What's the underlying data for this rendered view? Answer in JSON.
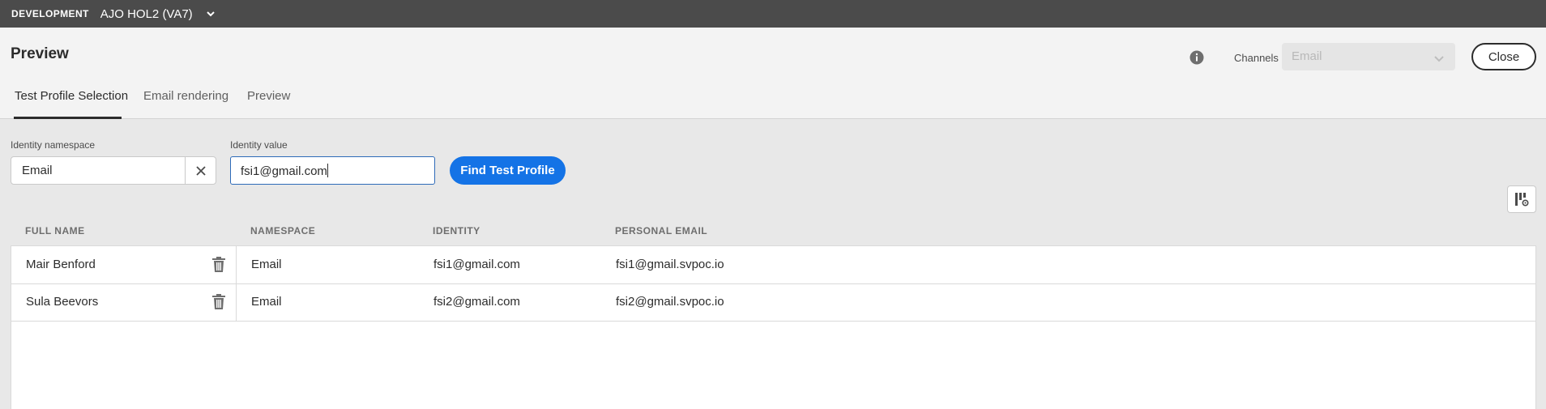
{
  "topbar": {
    "environment": "DEVELOPMENT",
    "sandbox": "AJO HOL2 (VA7)"
  },
  "header": {
    "title": "Preview",
    "channels_label": "Channels",
    "channel_value": "Email",
    "close_label": "Close"
  },
  "tabs": [
    {
      "label": "Test Profile Selection",
      "active": true
    },
    {
      "label": "Email rendering"
    },
    {
      "label": "Preview"
    }
  ],
  "form": {
    "namespace_label": "Identity namespace",
    "namespace_value": "Email",
    "identity_label": "Identity value",
    "identity_value": "fsi1@gmail.com",
    "find_label": "Find Test Profile"
  },
  "table": {
    "columns": [
      "FULL NAME",
      "NAMESPACE",
      "IDENTITY",
      "PERSONAL EMAIL"
    ],
    "rows": [
      {
        "full_name": "Mair Benford",
        "namespace": "Email",
        "identity": "fsi1@gmail.com",
        "personal_email": "fsi1@gmail.svpoc.io"
      },
      {
        "full_name": "Sula Beevors",
        "namespace": "Email",
        "identity": "fsi2@gmail.com",
        "personal_email": "fsi2@gmail.svpoc.io"
      }
    ]
  },
  "colors": {
    "topbar": "#4b4b4b",
    "accent": "#1473e6",
    "focus_border": "#2e6bb8"
  },
  "icons": [
    "chevron-down-icon",
    "info-icon",
    "close-icon",
    "trash-icon",
    "column-settings-icon"
  ]
}
